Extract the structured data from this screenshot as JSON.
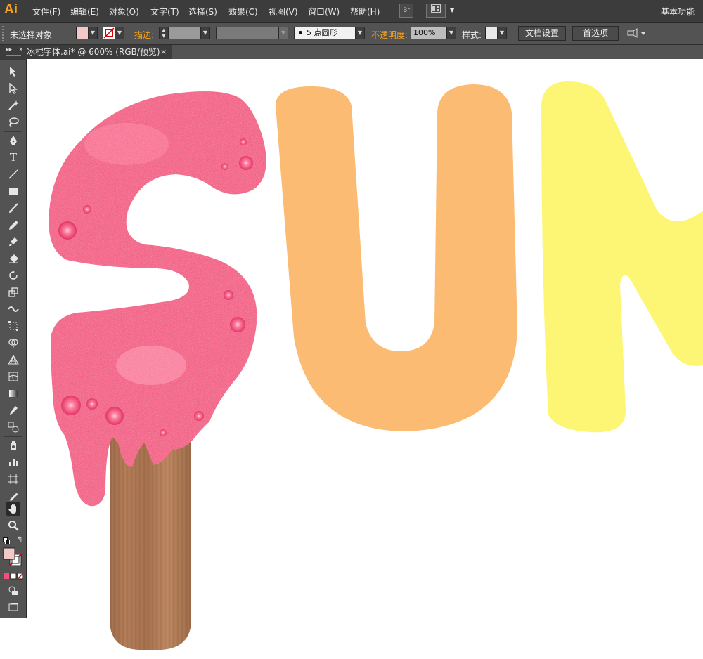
{
  "app": {
    "logo": "Ai"
  },
  "menu": [
    "文件(F)",
    "编辑(E)",
    "对象(O)",
    "文字(T)",
    "选择(S)",
    "效果(C)",
    "视图(V)",
    "窗口(W)",
    "帮助(H)"
  ],
  "menubar_icons": {
    "bridge": "Br",
    "arrange": "arrange-documents-icon"
  },
  "workspace": "基本功能",
  "control": {
    "selection": "未选择对象",
    "stroke_label": "描边:",
    "brush_value": "5 点圆形",
    "opacity_label": "不透明度:",
    "opacity_value": "100%",
    "style_label": "样式:",
    "doc_setup": "文档设置",
    "preferences": "首选项"
  },
  "document": {
    "tab_title": "冰棍字体.ai* @ 600% (RGB/预览)",
    "close": "×"
  },
  "tools": [
    "selection-tool-icon",
    "direct-selection-tool-icon",
    "magic-wand-tool-icon",
    "lasso-tool-icon",
    "pen-tool-icon",
    "type-tool-icon",
    "line-segment-tool-icon",
    "rectangle-tool-icon",
    "paintbrush-tool-icon",
    "pencil-tool-icon",
    "blob-brush-tool-icon",
    "eraser-tool-icon",
    "rotate-tool-icon",
    "scale-tool-icon",
    "width-tool-icon",
    "free-transform-tool-icon",
    "shape-builder-tool-icon",
    "perspective-grid-tool-icon",
    "mesh-tool-icon",
    "gradient-tool-icon",
    "eyedropper-tool-icon",
    "blend-tool-icon",
    "symbol-sprayer-tool-icon",
    "column-graph-tool-icon",
    "artboard-tool-icon",
    "slice-tool-icon",
    "hand-tool-icon",
    "zoom-tool-icon"
  ],
  "colors": {
    "accent": "#f7a21b",
    "letter_s": "#f24f7d",
    "letter_u": "#fbbb73",
    "letter_m": "#fdf675",
    "stick": "#a86e4a"
  }
}
